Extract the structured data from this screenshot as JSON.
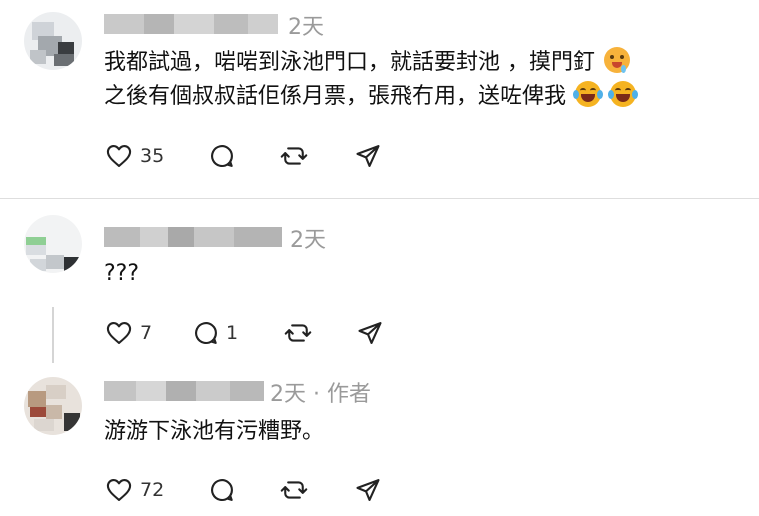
{
  "comments": [
    {
      "time": "2天",
      "author_tag": "",
      "lines": [
        "我都試過，啱啱到泳池門口，就話要封池 ，摸門釘",
        "之後有個叔叔話佢係月票，張飛冇用，送咗俾我"
      ],
      "emojis": [
        "drooling-face",
        "face-with-tears-of-joy",
        "face-with-tears-of-joy"
      ],
      "likes": "35",
      "replies": ""
    },
    {
      "time": "2天",
      "author_tag": "",
      "lines": [
        "???"
      ],
      "emojis": [],
      "likes": "7",
      "replies": "1"
    },
    {
      "time": "2天",
      "author_tag": "· 作者",
      "lines": [
        "游游下泳池有污糟野。"
      ],
      "emojis": [],
      "likes": "72",
      "replies": ""
    }
  ],
  "icons": {
    "like": "heart-icon",
    "reply": "comment-bubble-icon",
    "repost": "repost-icon",
    "share": "send-icon"
  },
  "colors": {
    "icon": "#222222",
    "muted": "#9a9a9a",
    "divider": "#dedede"
  }
}
